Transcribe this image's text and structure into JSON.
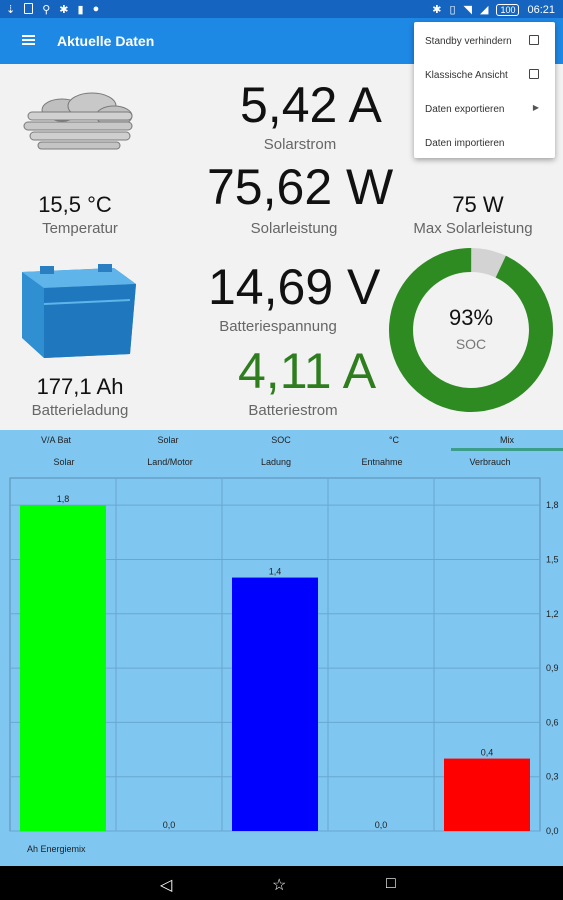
{
  "status": {
    "time": "06:21",
    "battery": "100"
  },
  "app": {
    "title": "Aktuelle Daten"
  },
  "menu": {
    "items": [
      {
        "label": "Standby verhindern"
      },
      {
        "label": "Klassische Ansicht"
      },
      {
        "label": "Daten exportieren"
      },
      {
        "label": "Daten importieren"
      }
    ]
  },
  "weather": {
    "temp_value": "15,5 °C",
    "temp_label": "Temperatur"
  },
  "battery": {
    "charge_value": "177,1 Ah",
    "charge_label": "Batterieladung"
  },
  "solar": {
    "current_value": "5,42 A",
    "current_label": "Solarstrom",
    "power_value": "75,62 W",
    "power_label": "Solarleistung",
    "max_value": "75 W",
    "max_label": "Max Solarleistung"
  },
  "batt": {
    "voltage_value": "14,69 V",
    "voltage_label": "Batteriespannung",
    "current_value": "4,11 A",
    "current_label": "Batteriestrom"
  },
  "soc": {
    "value": "93%",
    "label": "SOC",
    "fraction": 0.93,
    "color": "#2e8b22"
  },
  "tabs": {
    "top": [
      "V/A Bat",
      "Solar",
      "SOC",
      "°C",
      "Mix"
    ],
    "bottom": [
      "Solar",
      "Land/Motor",
      "Ladung",
      "Entnahme",
      "Verbrauch"
    ],
    "active": 4
  },
  "chart_data": {
    "type": "bar",
    "categories": [
      "Solar",
      "Land/Motor",
      "Ladung",
      "Entnahme",
      "Verbrauch"
    ],
    "values": [
      1.8,
      0.0,
      1.4,
      0.0,
      0.4
    ],
    "value_labels": [
      "1,8",
      "0,0",
      "1,4",
      "0,0",
      "0,4"
    ],
    "colors": [
      "#00ff00",
      null,
      "#0000ff",
      null,
      "#ff0000"
    ],
    "ylim": [
      0,
      1.95
    ],
    "yticks": [
      "0,0",
      "0,3",
      "0,6",
      "0,9",
      "1,2",
      "1,5",
      "1,8"
    ],
    "ytick_values": [
      0,
      0.3,
      0.6,
      0.9,
      1.2,
      1.5,
      1.8
    ],
    "legend": "Ah Energiemix",
    "grid": true
  }
}
